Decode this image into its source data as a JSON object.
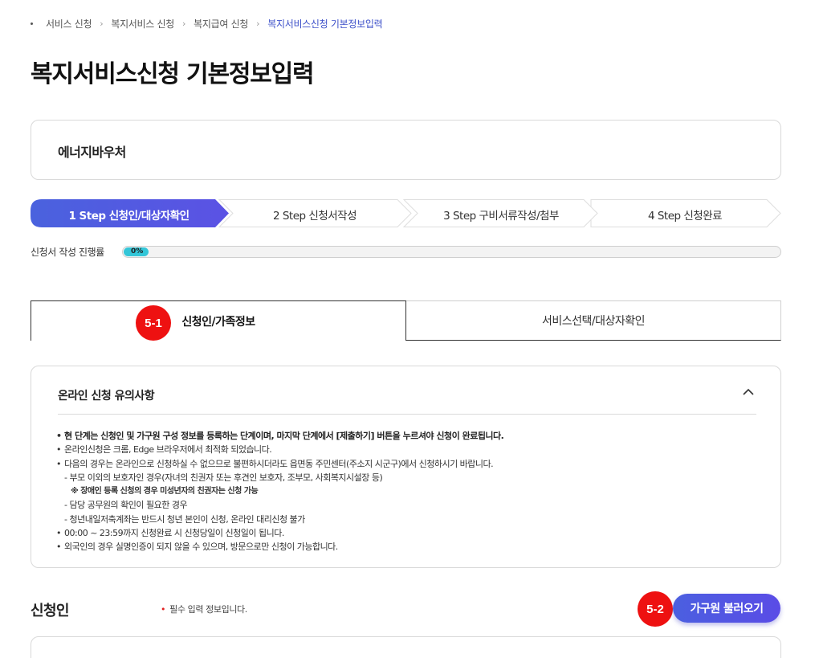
{
  "breadcrumb": {
    "items": [
      "서비스 신청",
      "복지서비스 신청",
      "복지급여 신청"
    ],
    "current": "복지서비스신청 기본정보입력"
  },
  "page_title": "복지서비스신청 기본정보입력",
  "service": {
    "name": "에너지바우처"
  },
  "steps": [
    {
      "label": "1 Step 신청인/대상자확인",
      "active": true
    },
    {
      "label": "2 Step 신청서작성",
      "active": false
    },
    {
      "label": "3 Step 구비서류작성/첨부",
      "active": false
    },
    {
      "label": "4 Step 신청완료",
      "active": false
    }
  ],
  "progress": {
    "label": "신청서 작성 진행률",
    "value_text": "0%",
    "value": 0
  },
  "tabs": [
    {
      "label": "신청인/가족정보",
      "active": true,
      "marker": "5-1"
    },
    {
      "label": "서비스선택/대상자확인",
      "active": false
    }
  ],
  "notice": {
    "title": "온라인 신청 유의사항",
    "items": [
      {
        "type": "bullet-strong",
        "text": "현 단계는 신청인 및 가구원 구성 정보를 등록하는 단계이며, 마지막 단계에서 [제출하기] 버튼을 누르셔야 신청이 완료됩니다."
      },
      {
        "type": "bullet",
        "text": "온라인신청은 크롬, Edge 브라우저에서 최적화 되었습니다."
      },
      {
        "type": "bullet",
        "text": "다음의 경우는 온라인으로 신청하실 수 없으므로 불편하시더라도 읍면동 주민센터(주소지 시군구)에서 신청하시기 바랍니다."
      },
      {
        "type": "dash",
        "text": "- 부모 이외의 보호자인 경우(자녀의 친권자 또는 후견인 보호자, 조부모, 사회복지시설장 등)"
      },
      {
        "type": "sub",
        "text": "※ 장애인 등록 신청의 경우 미성년자의 친권자는 신청 가능"
      },
      {
        "type": "dash",
        "text": "- 담당 공무원의 확인이 필요한 경우"
      },
      {
        "type": "dash",
        "text": "- 청년내일저축계좌는 반드시 청년 본인이 신청, 온라인 대리신청 불가"
      },
      {
        "type": "bullet",
        "text": "00:00 ~ 23:59까지 신청완료 시 신청당일이 신청일이 됩니다."
      },
      {
        "type": "bullet",
        "text": "외국인의 경우 실명인증이 되지 않을 수 있으며, 방문으로만 신청이 가능합니다."
      }
    ]
  },
  "applicant": {
    "title": "신청인",
    "required_note": "필수 입력 정보입니다.",
    "load_button": "가구원 불러오기",
    "load_marker": "5-2"
  },
  "colors": {
    "accent": "#4b5fe0",
    "progress_fill": "#33c6d8",
    "marker": "#ee1111",
    "breadcrumb_current": "#3d50c9"
  }
}
